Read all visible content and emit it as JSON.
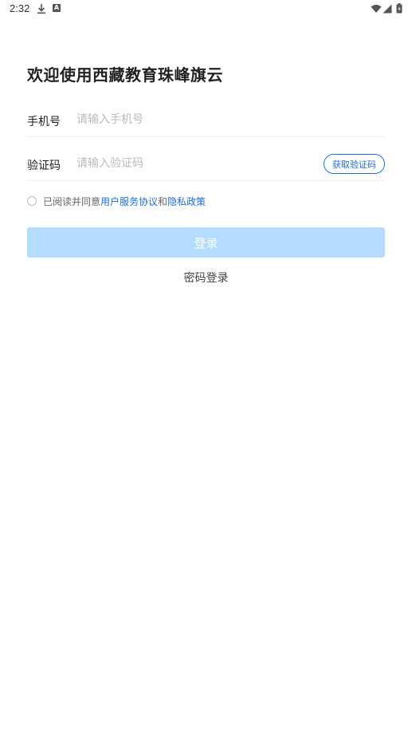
{
  "status_bar": {
    "time": "2:32",
    "icons": [
      "download-icon",
      "a-icon",
      "wifi-icon",
      "signal-icon",
      "battery-icon"
    ],
    "a_icon_text": "A"
  },
  "title": "欢迎使用西藏教育珠峰旗云",
  "form": {
    "phone": {
      "label": "手机号",
      "placeholder": "请输入手机号",
      "value": ""
    },
    "code": {
      "label": "验证码",
      "placeholder": "请输入验证码",
      "value": "",
      "get_code_label": "获取验证码"
    }
  },
  "agreement": {
    "checked": false,
    "prefix": "已阅读并同意",
    "user_agreement": "用户服务协议",
    "and": "和",
    "privacy_policy": "隐私政策"
  },
  "login_button": {
    "label": "登录"
  },
  "password_login_label": "密码登录",
  "colors": {
    "accent": "#1a6ee8",
    "button_disabled": "#b3dcff",
    "divider": "#eeeeee",
    "placeholder": "#bbbbbb"
  }
}
